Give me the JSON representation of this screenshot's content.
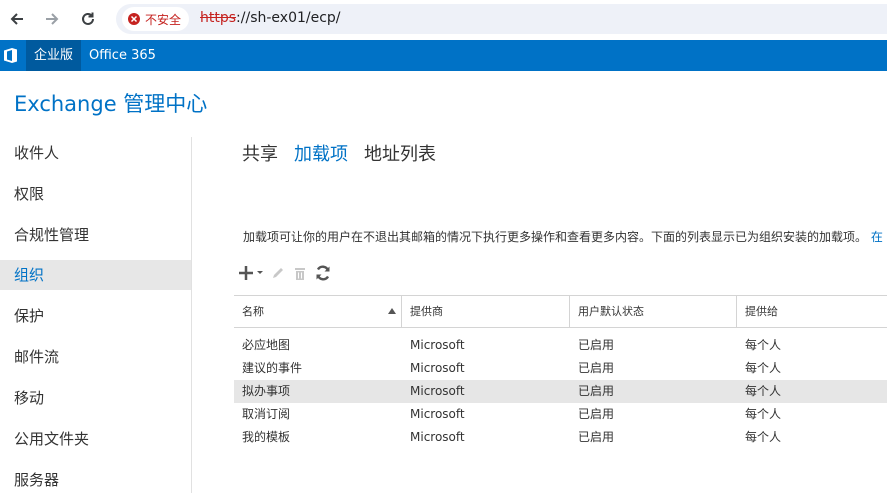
{
  "browser": {
    "security_label": "不安全",
    "url_scheme": "https",
    "url_rest": "://sh-ex01/ecp/"
  },
  "o365bar": {
    "product": "企业版",
    "office_link": "Office 365"
  },
  "app_title": "Exchange 管理中心",
  "nav": {
    "items": [
      {
        "label": "收件人"
      },
      {
        "label": "权限"
      },
      {
        "label": "合规性管理"
      },
      {
        "label": "组织",
        "active": true
      },
      {
        "label": "保护"
      },
      {
        "label": "邮件流"
      },
      {
        "label": "移动"
      },
      {
        "label": "公用文件夹"
      },
      {
        "label": "服务器"
      }
    ]
  },
  "tabs": [
    {
      "label": "共享"
    },
    {
      "label": "加载项",
      "active": true
    },
    {
      "label": "地址列表"
    }
  ],
  "description": {
    "text": "加载项可让你的用户在不退出其邮箱的情况下执行更多操作和查看更多内容。下面的列表显示已为组织安装的加载项。",
    "link": "在"
  },
  "toolbar": {
    "icons": [
      "add-icon",
      "edit-icon",
      "delete-icon",
      "refresh-icon"
    ]
  },
  "table": {
    "columns": [
      "名称",
      "提供商",
      "用户默认状态",
      "提供给"
    ],
    "rows": [
      {
        "name": "必应地图",
        "provider": "Microsoft",
        "status": "已启用",
        "available_to": "每个人"
      },
      {
        "name": "建议的事件",
        "provider": "Microsoft",
        "status": "已启用",
        "available_to": "每个人"
      },
      {
        "name": "拟办事项",
        "provider": "Microsoft",
        "status": "已启用",
        "available_to": "每个人",
        "selected": true
      },
      {
        "name": "取消订阅",
        "provider": "Microsoft",
        "status": "已启用",
        "available_to": "每个人"
      },
      {
        "name": "我的模板",
        "provider": "Microsoft",
        "status": "已启用",
        "available_to": "每个人"
      }
    ]
  },
  "colors": {
    "brand_blue": "#0072c6",
    "selected_nav": "#e7e7e7",
    "insecure_red": "#c5221f"
  }
}
